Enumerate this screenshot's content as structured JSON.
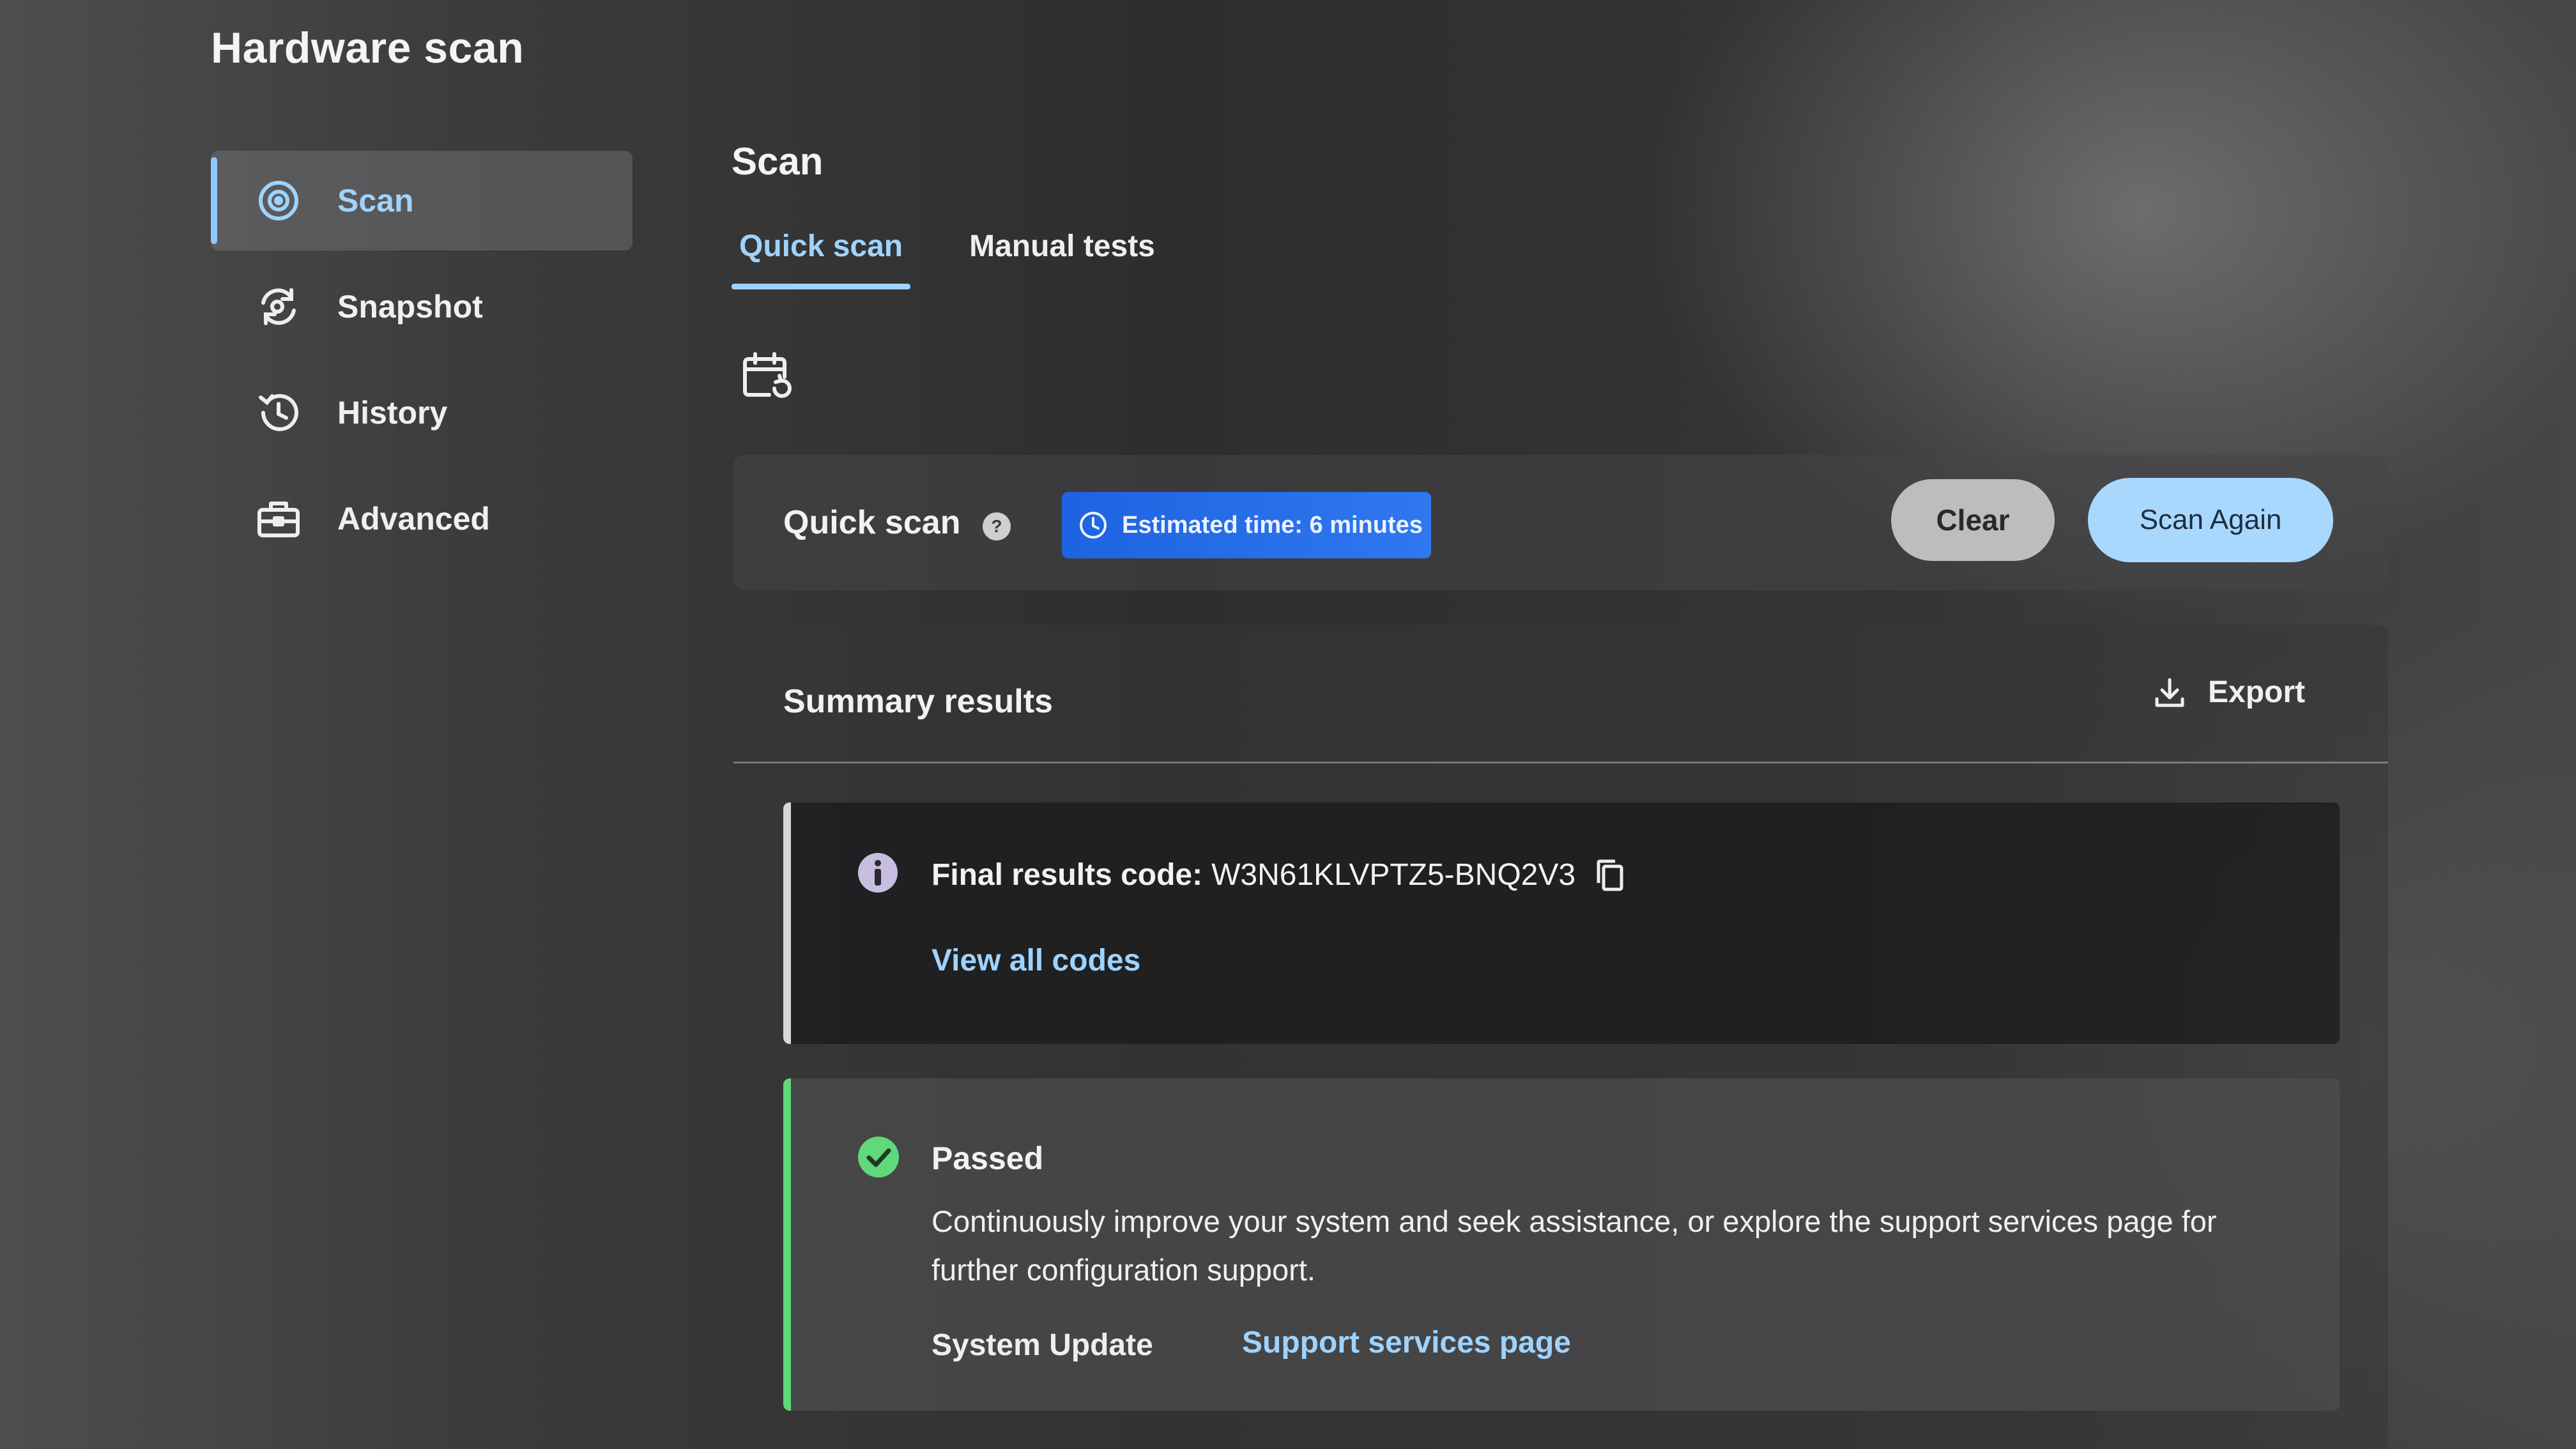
{
  "app": {
    "title": "Hardware scan"
  },
  "sidebar": {
    "items": [
      {
        "label": "Scan",
        "icon": "scan-target-icon",
        "active": true
      },
      {
        "label": "Snapshot",
        "icon": "snapshot-icon",
        "active": false
      },
      {
        "label": "History",
        "icon": "history-icon",
        "active": false
      },
      {
        "label": "Advanced",
        "icon": "toolbox-icon",
        "active": false
      }
    ]
  },
  "main": {
    "title": "Scan",
    "tabs": [
      {
        "label": "Quick scan",
        "active": true
      },
      {
        "label": "Manual tests",
        "active": false
      }
    ],
    "schedule_icon": "calendar-refresh-icon",
    "quick_scan": {
      "label": "Quick scan",
      "help_icon": "help-icon",
      "estimate": "Estimated time: 6 minutes",
      "clear_label": "Clear",
      "scan_again_label": "Scan Again"
    },
    "summary": {
      "title": "Summary results",
      "export_label": "Export",
      "results_code_label": "Final results code:",
      "results_code_value": "W3N61KLVPTZ5-BNQ2V3",
      "view_codes_label": "View all codes",
      "status_title": "Passed",
      "status_description": "Continuously improve your system and seek assistance, or explore the support services page for further configuration support.",
      "system_update_label": "System Update",
      "support_link_label": "Support services page"
    }
  },
  "colors": {
    "accent": "#9fd3ff",
    "badge_blue": "#2f78f0",
    "pass_green": "#5fd97a",
    "clear_button": "#bdbdbd",
    "scan_again_button": "#a9d8ff"
  }
}
